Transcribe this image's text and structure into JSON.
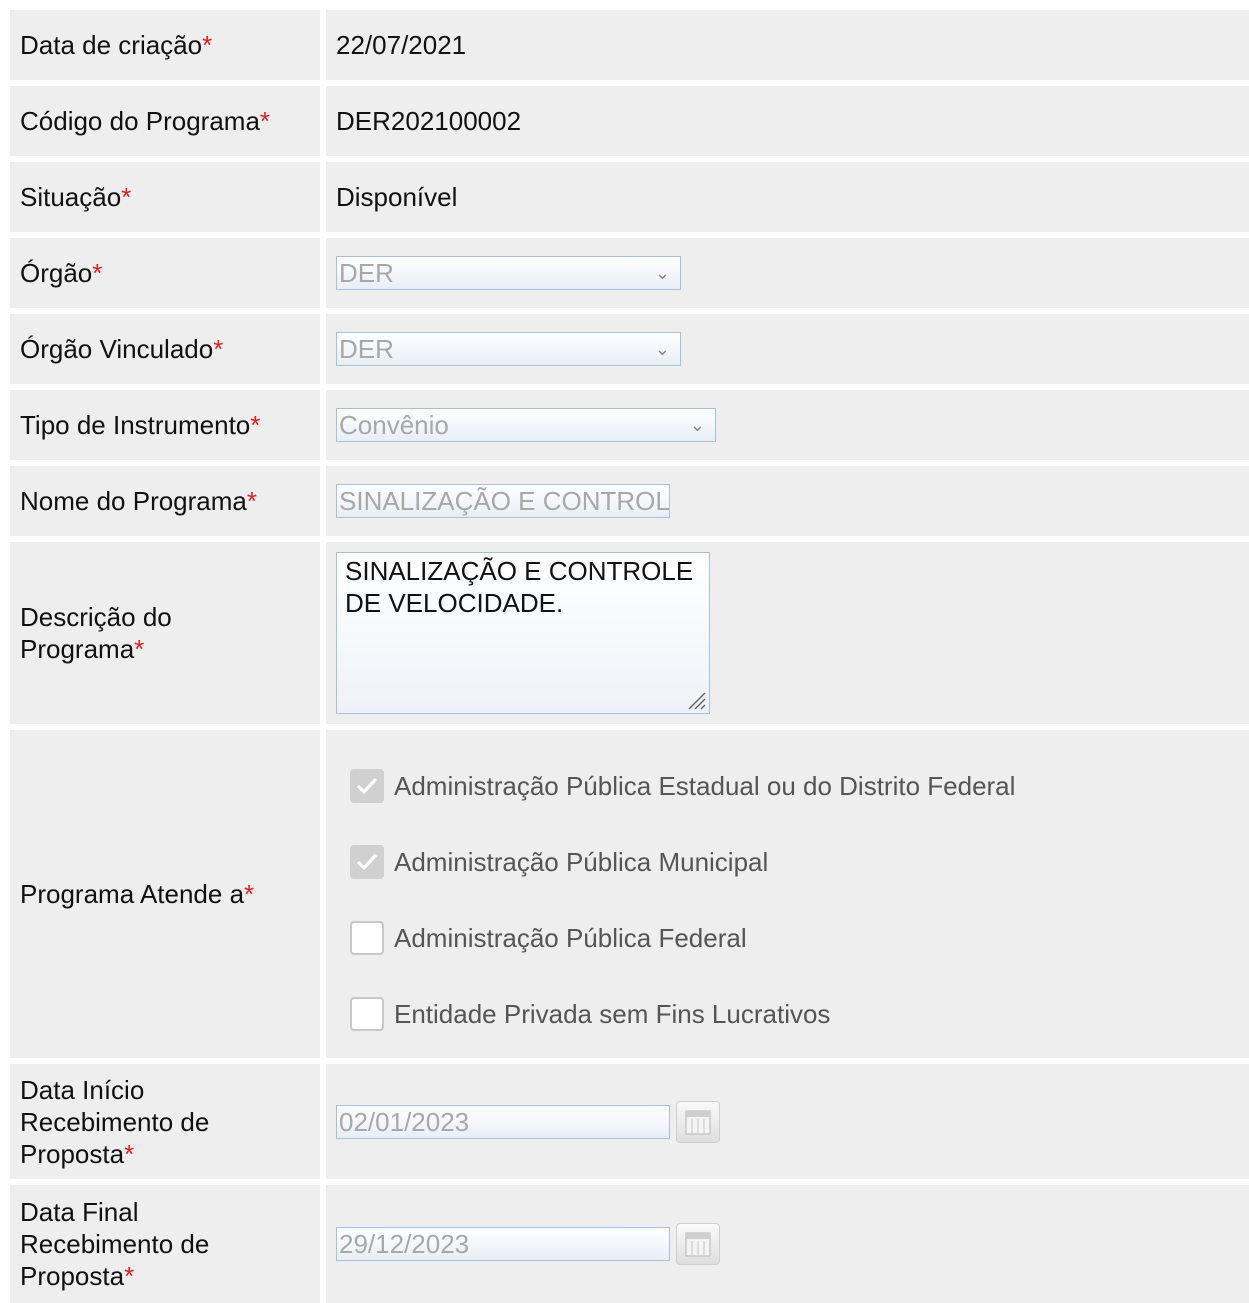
{
  "form": {
    "required_mark": "*",
    "data_criacao": {
      "label": "Data de criação",
      "value": "22/07/2021"
    },
    "codigo_programa": {
      "label": "Código do Programa",
      "value": "DER202100002"
    },
    "situacao": {
      "label": "Situação",
      "value": "Disponível"
    },
    "orgao": {
      "label": "Órgão",
      "value": "DER"
    },
    "orgao_vinculado": {
      "label": "Órgão Vinculado",
      "value": "DER"
    },
    "tipo_instrumento": {
      "label": "Tipo de Instrumento",
      "value": "Convênio"
    },
    "nome_programa": {
      "label": "Nome do Programa",
      "value": "SINALIZAÇÃO E CONTROLE DE VELOCIDADE."
    },
    "descricao_programa": {
      "label_line1": "Descrição do",
      "label_line2": "Programa",
      "value": "SINALIZAÇÃO E CONTROLE DE VELOCIDADE."
    },
    "programa_atende": {
      "label": "Programa Atende a",
      "options": [
        {
          "label": "Administração Pública Estadual ou do Distrito Federal",
          "checked": true
        },
        {
          "label": "Administração Pública Municipal",
          "checked": true
        },
        {
          "label": "Administração Pública Federal",
          "checked": false
        },
        {
          "label": "Entidade Privada sem Fins Lucrativos",
          "checked": false
        }
      ]
    },
    "data_inicio": {
      "label_line1": "Data Início",
      "label_line2": "Recebimento de",
      "label_line3": "Proposta",
      "value": "02/01/2023"
    },
    "data_final": {
      "label_line1": "Data Final",
      "label_line2": "Recebimento de",
      "label_line3": "Proposta",
      "value": "29/12/2023"
    }
  },
  "icons": {
    "dropdown": "chevron-down-icon",
    "check": "checkmark-icon",
    "calendar": "calendar-icon",
    "resize": "resize-grip-icon"
  },
  "colors": {
    "required": "#e02020",
    "row_bg": "#eeeeee",
    "input_border": "#a9c0da",
    "disabled_text": "#a8a8a8"
  }
}
